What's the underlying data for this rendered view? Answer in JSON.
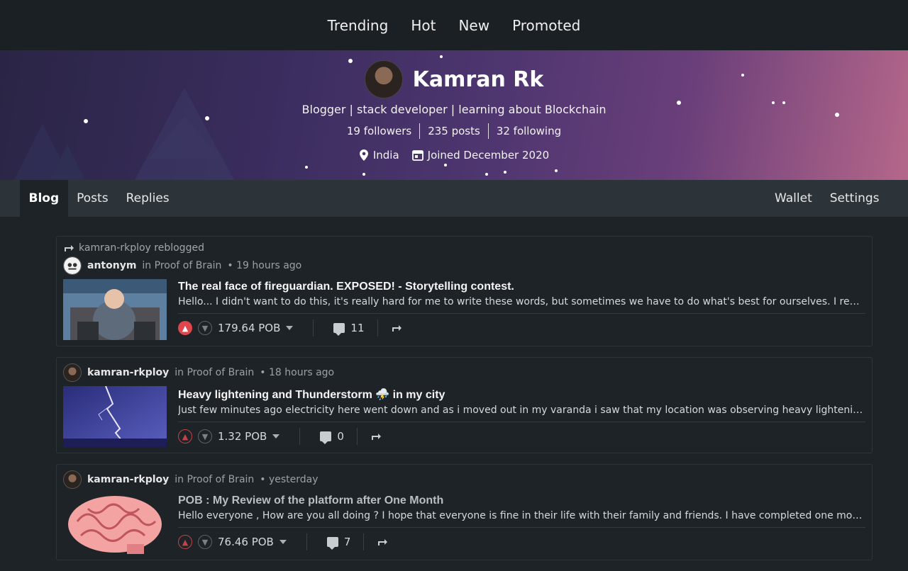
{
  "topnav": {
    "items": [
      "Trending",
      "Hot",
      "New",
      "Promoted"
    ]
  },
  "profile": {
    "name": "Kamran Rk",
    "bio": "Blogger | stack developer | learning about Blockchain",
    "followers": "19 followers",
    "posts": "235 posts",
    "following": "32 following",
    "location": "India",
    "joined": "Joined December 2020"
  },
  "subnav": {
    "tabs": [
      "Blog",
      "Posts",
      "Replies"
    ],
    "right": [
      "Wallet",
      "Settings"
    ]
  },
  "posts": [
    {
      "reblog": "kamran-rkploy reblogged",
      "author": "antonym",
      "community": "in Proof of Brain",
      "time": "• 19 hours ago",
      "title": "The real face of fireguardian. EXPOSED! - Storytelling contest.",
      "excerpt": "Hello... I didn't want to do this, it's really hard for me to write these words, but sometimes we have to do what's best for ourselves. I really enjoyed the storytelling contest and that's why I wrote this",
      "payout": "179.64 POB",
      "comments": "11"
    },
    {
      "author": "kamran-rkploy",
      "community": "in Proof of Brain",
      "time": "• 18 hours ago",
      "title": "Heavy lightening and Thunderstorm ⛈️ in my city",
      "excerpt": "Just few minutes ago electricity here went down and as i moved out in my varanda i saw that my location was observing heavy lightening and thunderstorm",
      "payout": "1.32 POB",
      "comments": "0"
    },
    {
      "author": "kamran-rkploy",
      "community": "in Proof of Brain",
      "time": "• yesterday",
      "title": "POB : My Review of the platform after One Month",
      "excerpt": "Hello everyone , How are you all doing ? I hope that everyone is fine in their life with their family and friends. I have completed one month on this platform",
      "payout": "76.46 POB",
      "comments": "7"
    }
  ],
  "colors": {
    "accent_red": "#e0474c",
    "page_bg": "#1e2327",
    "nav_bg": "#1b2024",
    "subnav_bg": "#2c3439"
  }
}
